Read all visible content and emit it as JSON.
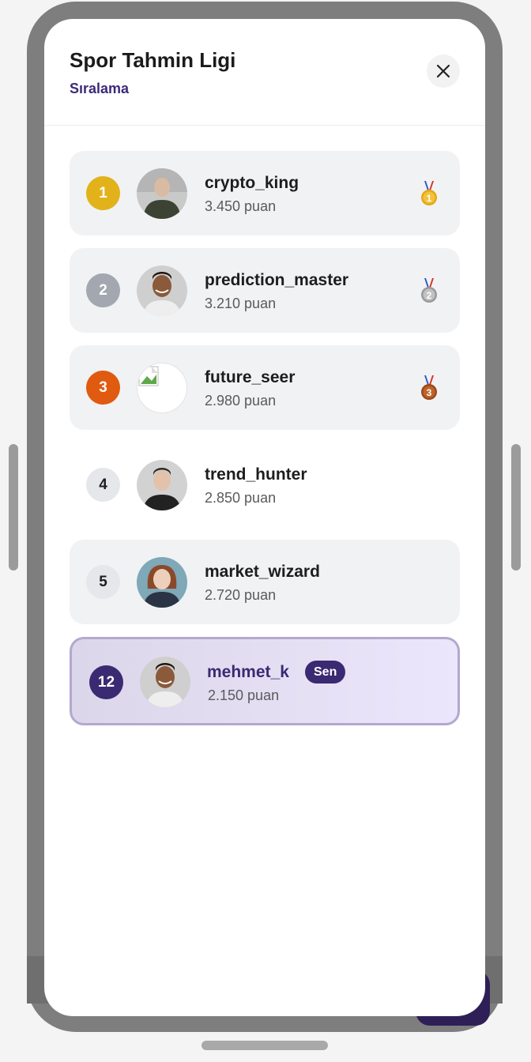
{
  "app": {
    "title": "Spor Tahmin Ligi",
    "subtitle": "Sıralama"
  },
  "leaderboard": [
    {
      "rank": "1",
      "username": "crypto_king",
      "points": "3.450 puan",
      "medal": "gold-medal-icon",
      "medal_number": "1"
    },
    {
      "rank": "2",
      "username": "prediction_master",
      "points": "3.210 puan",
      "medal": "silver-medal-icon",
      "medal_number": "2"
    },
    {
      "rank": "3",
      "username": "future_seer",
      "points": "2.980 puan",
      "medal": "bronze-medal-icon",
      "medal_number": "3"
    },
    {
      "rank": "4",
      "username": "trend_hunter",
      "points": "2.850 puan"
    },
    {
      "rank": "5",
      "username": "market_wizard",
      "points": "2.720 puan"
    }
  ],
  "current_user": {
    "rank": "12",
    "username": "mehmet_k",
    "badge": "Sen",
    "points": "2.150 puan"
  },
  "colors": {
    "accent": "#3a2a72",
    "gold": "#e2b21a",
    "silver": "#a2a7b0",
    "bronze": "#e05a0f"
  }
}
